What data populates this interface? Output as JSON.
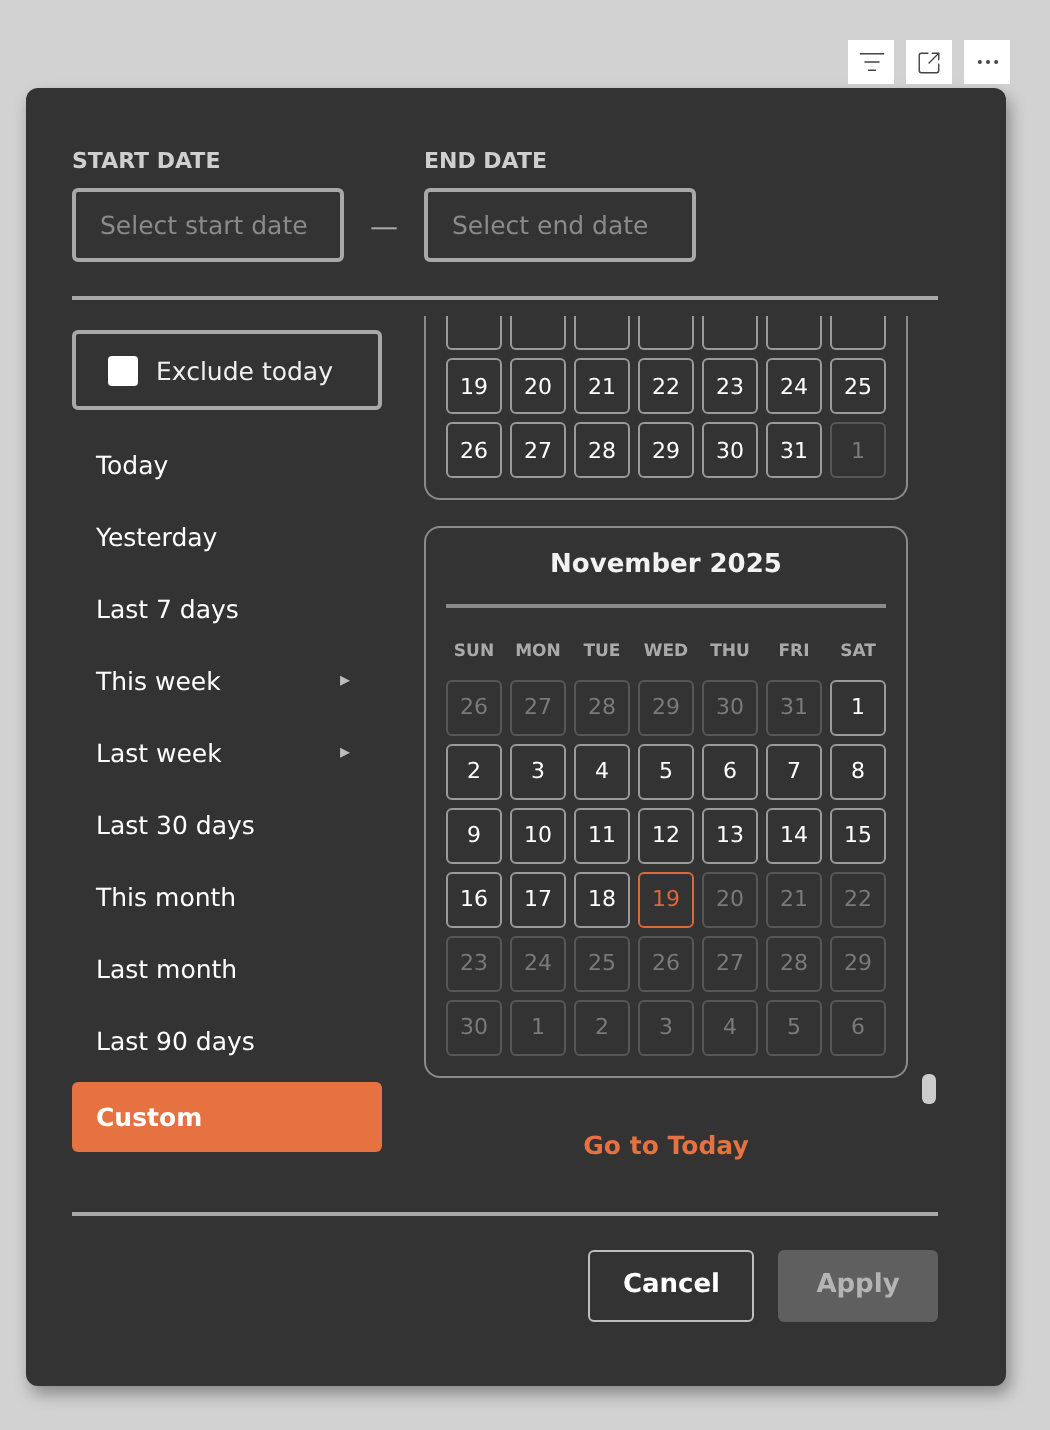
{
  "start_date": {
    "label": "START DATE",
    "placeholder": "Select start date"
  },
  "separator": "—",
  "end_date": {
    "label": "END DATE",
    "placeholder": "Select end date"
  },
  "exclude_today": {
    "label": "Exclude today",
    "checked": false
  },
  "presets": [
    {
      "label": "Today",
      "selected": false
    },
    {
      "label": "Yesterday",
      "selected": false
    },
    {
      "label": "Last 7 days",
      "selected": false
    },
    {
      "label": "This week",
      "selected": false,
      "submenu": "▸"
    },
    {
      "label": "Last week",
      "selected": false,
      "submenu": "▸"
    },
    {
      "label": "Last 30 days",
      "selected": false
    },
    {
      "label": "This month",
      "selected": false
    },
    {
      "label": "Last month",
      "selected": false
    },
    {
      "label": "Last 90 days",
      "selected": false
    },
    {
      "label": "Custom",
      "selected": true
    }
  ],
  "previous_month": {
    "rows": [
      [
        {
          "day": "19",
          "muted": false,
          "today": false
        },
        {
          "day": "20",
          "muted": false,
          "today": false
        },
        {
          "day": "21",
          "muted": false,
          "today": false
        },
        {
          "day": "22",
          "muted": false,
          "today": false
        },
        {
          "day": "23",
          "muted": false,
          "today": false
        },
        {
          "day": "24",
          "muted": false,
          "today": false
        },
        {
          "day": "25",
          "muted": false,
          "today": false
        }
      ],
      [
        {
          "day": "26",
          "muted": false,
          "today": false
        },
        {
          "day": "27",
          "muted": false,
          "today": false
        },
        {
          "day": "28",
          "muted": false,
          "today": false
        },
        {
          "day": "29",
          "muted": false,
          "today": false
        },
        {
          "day": "30",
          "muted": false,
          "today": false
        },
        {
          "day": "31",
          "muted": false,
          "today": false
        },
        {
          "day": "1",
          "muted": true,
          "today": false
        }
      ]
    ]
  },
  "current_month": {
    "title": "November 2025",
    "weekdays": [
      "SUN",
      "MON",
      "TUE",
      "WED",
      "THU",
      "FRI",
      "SAT"
    ],
    "rows": [
      [
        {
          "day": "26",
          "muted": true,
          "today": false
        },
        {
          "day": "27",
          "muted": true,
          "today": false
        },
        {
          "day": "28",
          "muted": true,
          "today": false
        },
        {
          "day": "29",
          "muted": true,
          "today": false
        },
        {
          "day": "30",
          "muted": true,
          "today": false
        },
        {
          "day": "31",
          "muted": true,
          "today": false
        },
        {
          "day": "1",
          "muted": false,
          "today": false
        }
      ],
      [
        {
          "day": "2",
          "muted": false,
          "today": false
        },
        {
          "day": "3",
          "muted": false,
          "today": false
        },
        {
          "day": "4",
          "muted": false,
          "today": false
        },
        {
          "day": "5",
          "muted": false,
          "today": false
        },
        {
          "day": "6",
          "muted": false,
          "today": false
        },
        {
          "day": "7",
          "muted": false,
          "today": false
        },
        {
          "day": "8",
          "muted": false,
          "today": false
        }
      ],
      [
        {
          "day": "9",
          "muted": false,
          "today": false
        },
        {
          "day": "10",
          "muted": false,
          "today": false
        },
        {
          "day": "11",
          "muted": false,
          "today": false
        },
        {
          "day": "12",
          "muted": false,
          "today": false
        },
        {
          "day": "13",
          "muted": false,
          "today": false
        },
        {
          "day": "14",
          "muted": false,
          "today": false
        },
        {
          "day": "15",
          "muted": false,
          "today": false
        }
      ],
      [
        {
          "day": "16",
          "muted": false,
          "today": false
        },
        {
          "day": "17",
          "muted": false,
          "today": false
        },
        {
          "day": "18",
          "muted": false,
          "today": false
        },
        {
          "day": "19",
          "muted": false,
          "today": true
        },
        {
          "day": "20",
          "muted": true,
          "today": false
        },
        {
          "day": "21",
          "muted": true,
          "today": false
        },
        {
          "day": "22",
          "muted": true,
          "today": false
        }
      ],
      [
        {
          "day": "23",
          "muted": true,
          "today": false
        },
        {
          "day": "24",
          "muted": true,
          "today": false
        },
        {
          "day": "25",
          "muted": true,
          "today": false
        },
        {
          "day": "26",
          "muted": true,
          "today": false
        },
        {
          "day": "27",
          "muted": true,
          "today": false
        },
        {
          "day": "28",
          "muted": true,
          "today": false
        },
        {
          "day": "29",
          "muted": true,
          "today": false
        }
      ],
      [
        {
          "day": "30",
          "muted": true,
          "today": false
        },
        {
          "day": "1",
          "muted": true,
          "today": false
        },
        {
          "day": "2",
          "muted": true,
          "today": false
        },
        {
          "day": "3",
          "muted": true,
          "today": false
        },
        {
          "day": "4",
          "muted": true,
          "today": false
        },
        {
          "day": "5",
          "muted": true,
          "today": false
        },
        {
          "day": "6",
          "muted": true,
          "today": false
        }
      ]
    ]
  },
  "go_to_today": "Go to Today",
  "buttons": [
    {
      "label": "Cancel",
      "disabled": false
    },
    {
      "label": "Apply",
      "disabled": true
    }
  ]
}
